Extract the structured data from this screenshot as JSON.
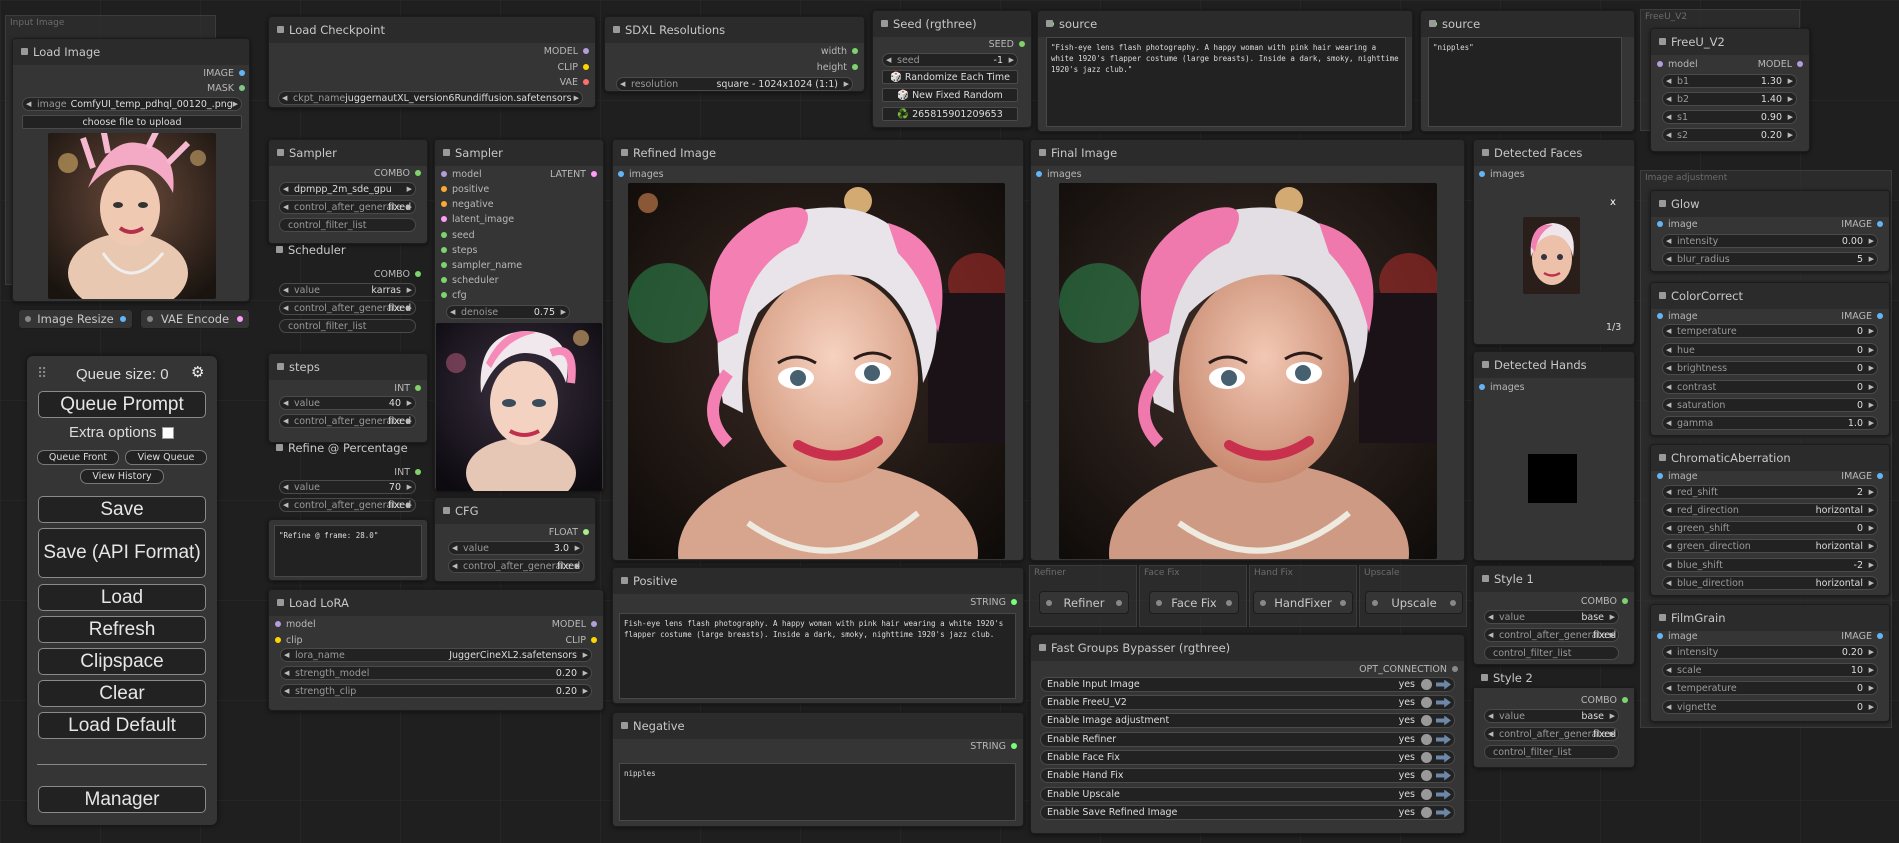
{
  "colors": {
    "image": "#64b5f6",
    "mask": "#81c784",
    "model": "#b39ddb",
    "clip": "#ffd500",
    "vae": "#ff6e6e",
    "latent": "#ff9cf9",
    "int": "#7ed36c",
    "conditioning": "#ffa931",
    "float": "#aaee88",
    "string": "#77ff77"
  },
  "groups": {
    "input_image": "Input Image",
    "freeu": "FreeU_V2",
    "image_adjustment": "Image adjustment",
    "refiner": "Refiner",
    "face_fix": "Face Fix",
    "hand_fix": "Hand Fix",
    "upscale": "Upscale"
  },
  "load_image": {
    "title": "Load Image",
    "out_image": "IMAGE",
    "out_mask": "MASK",
    "image_label": "image",
    "image_value": "ComfyUI_temp_pdhql_00120_.png",
    "upload": "choose file to upload"
  },
  "image_resize": {
    "title": "Image Resize"
  },
  "vae_encode": {
    "title": "VAE Encode"
  },
  "load_checkpoint": {
    "title": "Load Checkpoint",
    "out_model": "MODEL",
    "out_clip": "CLIP",
    "out_vae": "VAE",
    "ckpt_label": "ckpt_name",
    "ckpt_value": "juggernautXL_version6Rundiffusion.safetensors"
  },
  "sdxl": {
    "title": "SDXL Resolutions",
    "out_width": "width",
    "out_height": "height",
    "res_label": "resolution",
    "res_value": "square - 1024x1024 (1:1)"
  },
  "seed": {
    "title": "Seed (rgthree)",
    "out": "SEED",
    "seed_label": "seed",
    "seed_value": "-1",
    "randomize": "🎲 Randomize Each Time",
    "new_fixed": "🎲 New Fixed Random",
    "last": "♻️ 265815901209653"
  },
  "source1": {
    "title": "source",
    "text": "\"Fish-eye lens flash photography. A happy woman with pink hair wearing a white 1920's flapper costume (large breasts). Inside a dark, smoky, nighttime 1920's jazz club.\""
  },
  "source2": {
    "title": "source",
    "text": "\"nipples\""
  },
  "freeu": {
    "title": "FreeU_V2",
    "in_model": "model",
    "out_model": "MODEL",
    "rows": [
      {
        "label": "b1",
        "value": "1.30"
      },
      {
        "label": "b2",
        "value": "1.40"
      },
      {
        "label": "s1",
        "value": "0.90"
      },
      {
        "label": "s2",
        "value": "0.20"
      }
    ]
  },
  "sampler1": {
    "title": "Sampler",
    "out": "COMBO",
    "sampler_value": "dpmpp_2m_sde_gpu",
    "sampler_overlap": "Sampler",
    "control_label": "control_after_generate",
    "control_value": "fixed",
    "filter": "control_filter_list"
  },
  "scheduler": {
    "title": "Scheduler",
    "out": "COMBO",
    "value_label": "value",
    "value": "karras",
    "control_label": "control_after_generate",
    "control_value": "fixed",
    "filter": "control_filter_list"
  },
  "steps": {
    "title": "steps",
    "out": "INT",
    "value_label": "value",
    "value": "40",
    "control_label": "control_after_generate",
    "control_value": "fixed"
  },
  "refine_pct": {
    "title": "Refine @ Percentage",
    "out": "INT",
    "value_label": "value",
    "value": "70",
    "control_label": "control_after_generate",
    "control_value": "fixed",
    "text": "\"Refine @ frame: 28.0\""
  },
  "sampler2": {
    "title": "Sampler",
    "out": "LATENT",
    "inputs": [
      "model",
      "positive",
      "negative",
      "latent_image",
      "seed",
      "steps",
      "sampler_name",
      "scheduler",
      "cfg"
    ],
    "denoise_label": "denoise",
    "denoise_value": "0.75"
  },
  "cfg": {
    "title": "CFG",
    "out": "FLOAT",
    "value_label": "value",
    "value": "3.0",
    "control_label": "control_after_generate",
    "control_value": "fixed"
  },
  "lora": {
    "title": "Load LoRA",
    "in_model": "model",
    "in_clip": "clip",
    "out_model": "MODEL",
    "out_clip": "CLIP",
    "rows": [
      {
        "label": "lora_name",
        "value": "JuggerCineXL2.safetensors"
      },
      {
        "label": "strength_model",
        "value": "0.20"
      },
      {
        "label": "strength_clip",
        "value": "0.20"
      }
    ]
  },
  "refined": {
    "title": "Refined Image",
    "in": "images"
  },
  "final": {
    "title": "Final Image",
    "in": "images"
  },
  "faces": {
    "title": "Detected Faces",
    "in": "images",
    "close": "x",
    "count": "1/3"
  },
  "hands": {
    "title": "Detected Hands",
    "in": "images"
  },
  "positive": {
    "title": "Positive",
    "out": "STRING",
    "text": "Fish-eye lens flash photography. A happy woman with pink hair wearing a white 1920's flapper costume (large breasts). Inside a dark, smoky, nighttime 1920's jazz club."
  },
  "negative": {
    "title": "Negative",
    "out": "STRING",
    "text": "nipples"
  },
  "bypass_groups": {
    "refiner": "Refiner",
    "face_fix": "Face Fix",
    "hand_fixer": "HandFixer",
    "upscale": "Upscale"
  },
  "fast_groups": {
    "title": "Fast Groups Bypasser (rgthree)",
    "out": "OPT_CONNECTION",
    "rows": [
      {
        "label": "Enable Input Image",
        "value": "yes"
      },
      {
        "label": "Enable FreeU_V2",
        "value": "yes"
      },
      {
        "label": "Enable Image adjustment",
        "value": "yes"
      },
      {
        "label": "Enable Refiner",
        "value": "yes"
      },
      {
        "label": "Enable Face Fix",
        "value": "yes"
      },
      {
        "label": "Enable Hand Fix",
        "value": "yes"
      },
      {
        "label": "Enable Upscale",
        "value": "yes"
      },
      {
        "label": "Enable Save Refined Image",
        "value": "yes"
      }
    ]
  },
  "style1": {
    "title": "Style 1",
    "out": "COMBO",
    "value_label": "value",
    "value": "base",
    "control_label": "control_after_generate",
    "control_value": "fixed",
    "filter": "control_filter_list"
  },
  "style2": {
    "title": "Style 2",
    "out": "COMBO",
    "value_label": "value",
    "value": "base",
    "control_label": "control_after_generate",
    "control_value": "fixed",
    "filter": "control_filter_list"
  },
  "glow": {
    "title": "Glow",
    "in": "image",
    "out": "IMAGE",
    "rows": [
      {
        "label": "intensity",
        "value": "0.00"
      },
      {
        "label": "blur_radius",
        "value": "5"
      }
    ]
  },
  "colorcorrect": {
    "title": "ColorCorrect",
    "in": "image",
    "out": "IMAGE",
    "rows": [
      {
        "label": "temperature",
        "value": "0"
      },
      {
        "label": "hue",
        "value": "0"
      },
      {
        "label": "brightness",
        "value": "0"
      },
      {
        "label": "contrast",
        "value": "0"
      },
      {
        "label": "saturation",
        "value": "0"
      },
      {
        "label": "gamma",
        "value": "1.0"
      }
    ]
  },
  "chromatic": {
    "title": "ChromaticAberration",
    "in": "image",
    "out": "IMAGE",
    "rows": [
      {
        "label": "red_shift",
        "value": "2"
      },
      {
        "label": "red_direction",
        "value": "horizontal"
      },
      {
        "label": "green_shift",
        "value": "0"
      },
      {
        "label": "green_direction",
        "value": "horizontal"
      },
      {
        "label": "blue_shift",
        "value": "-2"
      },
      {
        "label": "blue_direction",
        "value": "horizontal"
      }
    ]
  },
  "filmgrain": {
    "title": "FilmGrain",
    "in": "image",
    "out": "IMAGE",
    "rows": [
      {
        "label": "intensity",
        "value": "0.20"
      },
      {
        "label": "scale",
        "value": "10"
      },
      {
        "label": "temperature",
        "value": "0"
      },
      {
        "label": "vignette",
        "value": "0"
      }
    ]
  },
  "queue": {
    "grip": "⠿",
    "size": "Queue size: 0",
    "gear": "⚙",
    "queue_prompt": "Queue Prompt",
    "extra": "Extra options",
    "queue_front": "Queue Front",
    "view_queue": "View Queue",
    "view_history": "View History",
    "save": "Save",
    "save_api": "Save (API Format)",
    "load": "Load",
    "refresh": "Refresh",
    "clipspace": "Clipspace",
    "clear": "Clear",
    "load_default": "Load Default",
    "manager": "Manager"
  }
}
